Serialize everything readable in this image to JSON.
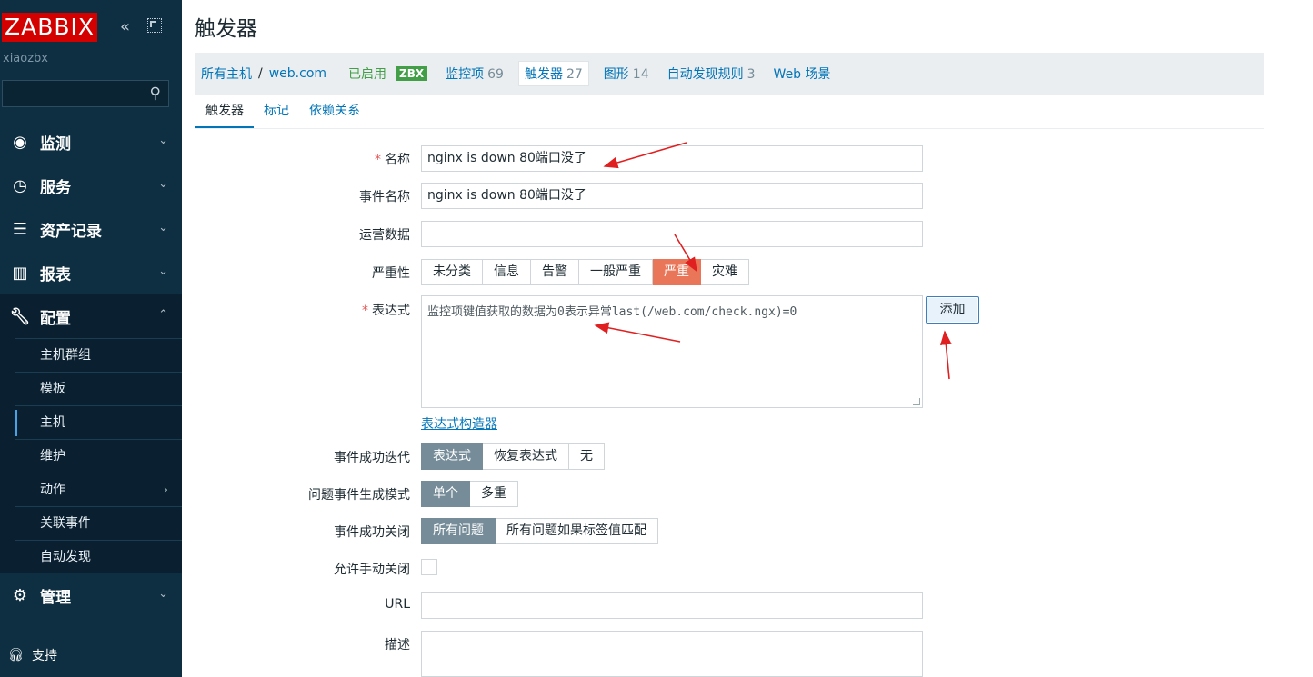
{
  "sidebar": {
    "logo": "ZABBIX",
    "collapse_icon": "double-chevron-left-icon",
    "kiosk_icon": "kiosk-mode-icon",
    "server_name": "xiaozbx",
    "search": {
      "value": "",
      "placeholder": ""
    },
    "menu": [
      {
        "label": "监测",
        "icon": "eye-icon"
      },
      {
        "label": "服务",
        "icon": "clock-icon"
      },
      {
        "label": "资产记录",
        "icon": "list-icon"
      },
      {
        "label": "报表",
        "icon": "bar-chart-icon"
      },
      {
        "label": "配置",
        "icon": "wrench-icon"
      },
      {
        "label": "管理",
        "icon": "gear-icon"
      }
    ],
    "config_submenu": [
      "主机群组",
      "模板",
      "主机",
      "维护",
      "动作",
      "关联事件",
      "自动发现"
    ],
    "support": "支持"
  },
  "page": {
    "title": "触发器"
  },
  "host_nav": {
    "all_hosts": "所有主机",
    "separator": "/",
    "host": "web.com",
    "enabled": "已启用",
    "zbx": "ZBX",
    "items_label": "监控项",
    "items_count": "69",
    "triggers_label": "触发器",
    "triggers_count": "27",
    "graphs_label": "图形",
    "graphs_count": "14",
    "discovery_label": "自动发现规则",
    "discovery_count": "3",
    "web_label": "Web 场景"
  },
  "tabs": [
    "触发器",
    "标记",
    "依赖关系"
  ],
  "form": {
    "name": {
      "label": "名称",
      "value": "nginx is down 80端口没了"
    },
    "event_name": {
      "label": "事件名称",
      "value": "nginx is down 80端口没了"
    },
    "opdata": {
      "label": "运营数据",
      "value": ""
    },
    "severity": {
      "label": "严重性",
      "options": [
        "未分类",
        "信息",
        "告警",
        "一般严重",
        "严重",
        "灾难"
      ],
      "selected": "严重"
    },
    "expression": {
      "label": "表达式",
      "value": "监控项键值获取的数据为0表示异常last(/web.com/check.ngx)=0",
      "add_button": "添加",
      "constructor_link": "表达式构造器"
    },
    "ok_event": {
      "label": "事件成功迭代",
      "options": [
        "表达式",
        "恢复表达式",
        "无"
      ],
      "selected": "表达式"
    },
    "problem_mode": {
      "label": "问题事件生成模式",
      "options": [
        "单个",
        "多重"
      ],
      "selected": "单个"
    },
    "ok_close": {
      "label": "事件成功关闭",
      "options": [
        "所有问题",
        "所有问题如果标签值匹配"
      ],
      "selected": "所有问题"
    },
    "manual_close": {
      "label": "允许手动关闭",
      "checked": false
    },
    "url": {
      "label": "URL",
      "value": ""
    },
    "description": {
      "label": "描述",
      "value": ""
    }
  },
  "colors": {
    "sidebar_bg": "#0e2f42",
    "logo_bg": "#d40000",
    "link": "#0275b8",
    "severity_high": "#e97659",
    "segment_on": "#768d99",
    "annotation_arrow": "#e02020"
  }
}
